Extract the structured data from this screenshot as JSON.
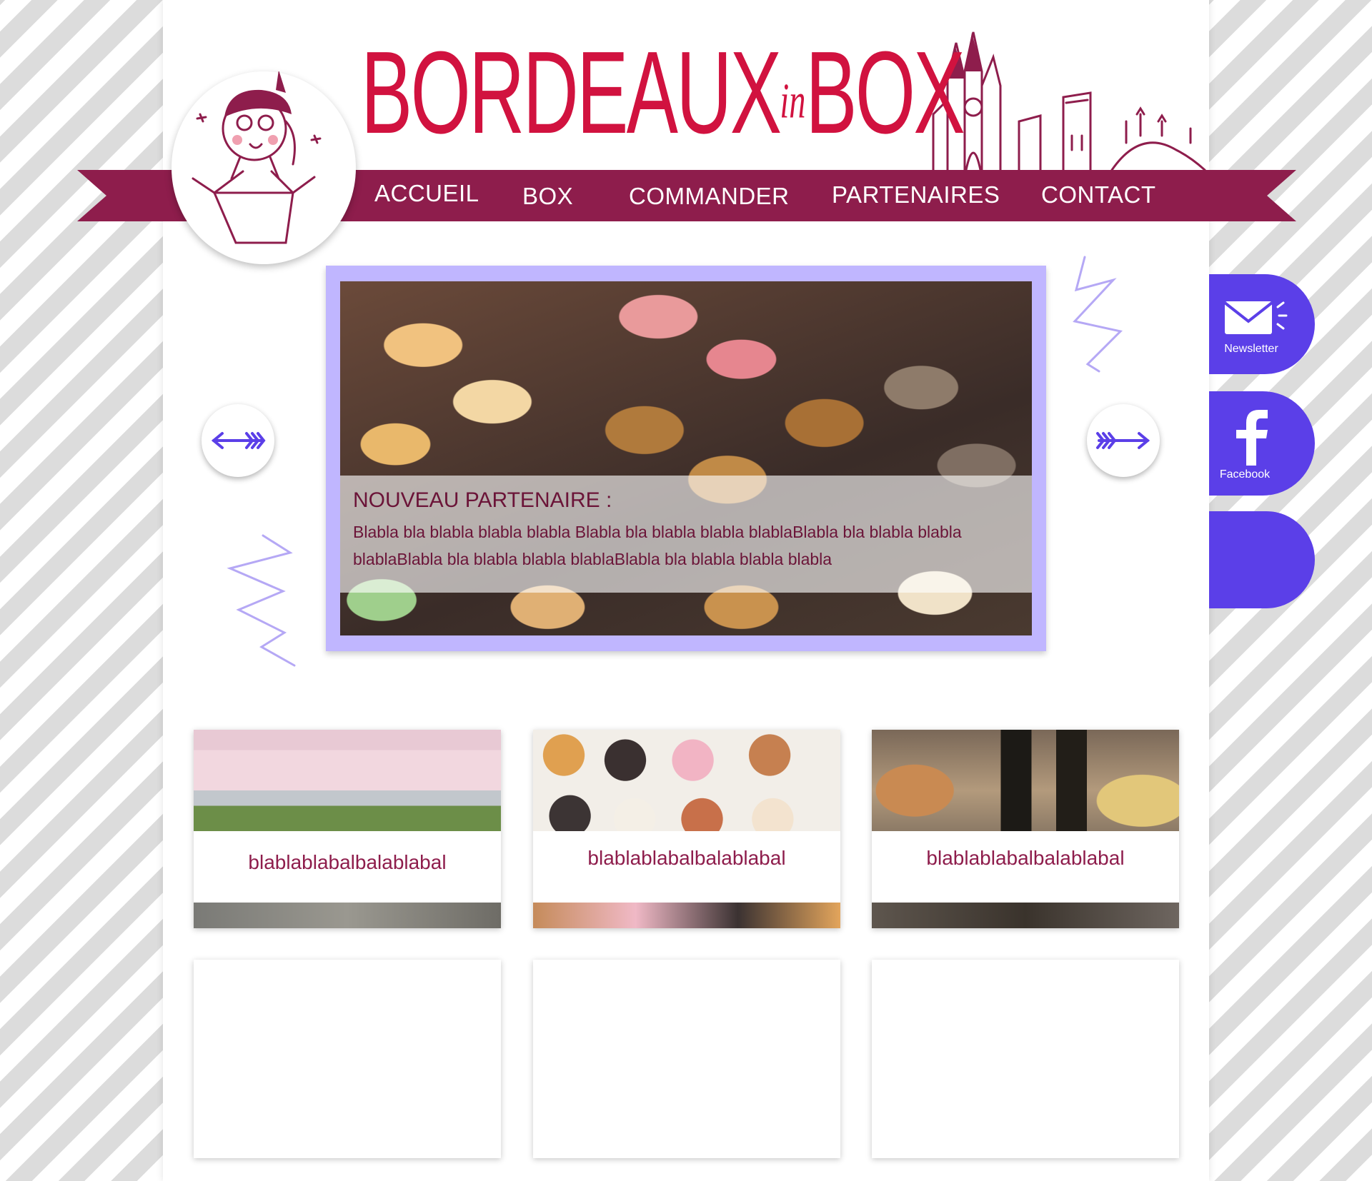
{
  "brand": {
    "part1": "BORDEAUX",
    "part2": "in",
    "part3": "BOX"
  },
  "nav": {
    "items": [
      {
        "label": "ACCUEIL"
      },
      {
        "label": "BOX"
      },
      {
        "label": "COMMANDER"
      },
      {
        "label": "PARTENAIRES"
      },
      {
        "label": "CONTACT"
      }
    ]
  },
  "slider": {
    "title": "NOUVEAU PARTENAIRE :",
    "text": "Blabla bla blabla blabla blabla Blabla bla blabla blabla blablaBlabla bla blabla blabla blablaBlabla bla blabla blabla blablaBlabla bla blabla blabla blabla",
    "prev_icon": "arrow-left-icon",
    "next_icon": "arrow-right-icon"
  },
  "side": {
    "newsletter_label": "Newsletter",
    "facebook_label": "Facebook"
  },
  "cards": [
    {
      "label": "blablablabalbalablabal"
    },
    {
      "label": "blablablabalbalablabal"
    },
    {
      "label": "blablablabalbalablabal"
    }
  ],
  "colors": {
    "brand_red": "#d1123f",
    "ribbon": "#8e1d4c",
    "accent_purple": "#5b3fe8",
    "slider_frame": "#c0b6ff"
  }
}
